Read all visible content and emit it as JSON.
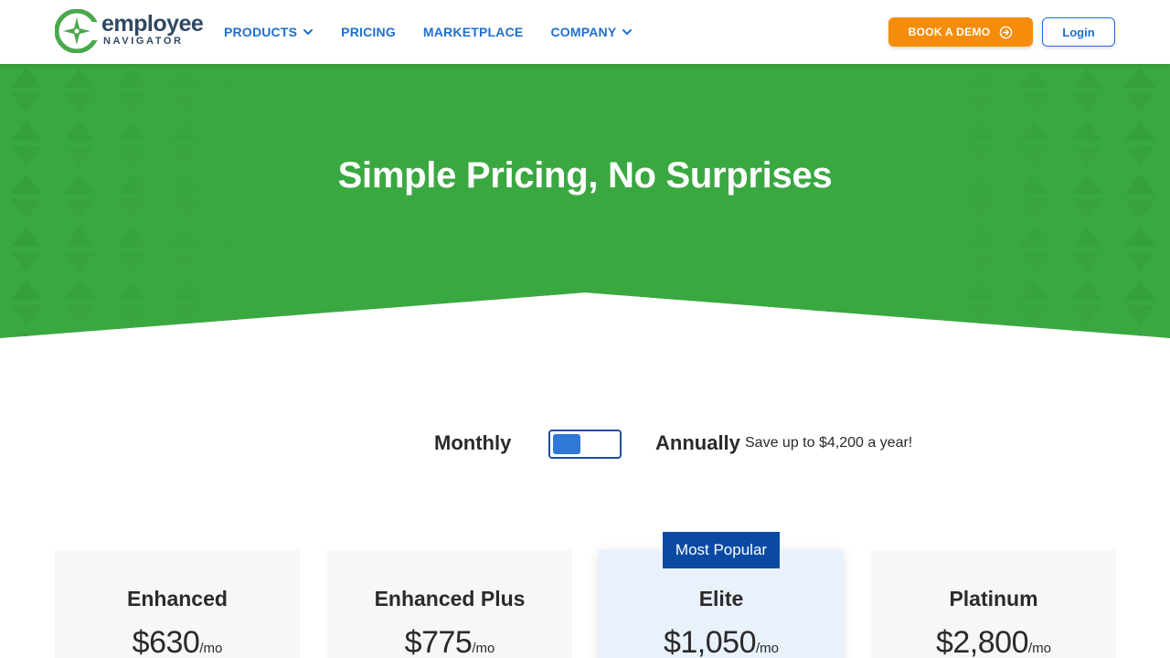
{
  "brand": {
    "logo_word": "employee",
    "logo_sub": "NAVIGATOR",
    "primary_color": "#1f6fcf",
    "hero_green": "#3aa840",
    "accent_orange": "#f68d0a"
  },
  "nav": {
    "items": [
      {
        "label": "PRODUCTS",
        "has_dropdown": true
      },
      {
        "label": "PRICING",
        "has_dropdown": false
      },
      {
        "label": "MARKETPLACE",
        "has_dropdown": false
      },
      {
        "label": "COMPANY",
        "has_dropdown": true
      }
    ],
    "book_demo_label": "BOOK A DEMO",
    "login_label": "Login"
  },
  "hero": {
    "title": "Simple Pricing, No Surprises"
  },
  "billing": {
    "monthly_label": "Monthly",
    "annual_label": "Annually",
    "save_note": "Save up to $4,200 a year!",
    "selected": "Monthly"
  },
  "plans": [
    {
      "name": "Enhanced",
      "price": "$630",
      "unit": "/mo"
    },
    {
      "name": "Enhanced Plus",
      "price": "$775",
      "unit": "/mo"
    },
    {
      "name": "Elite",
      "price": "$1,050",
      "unit": "/mo",
      "badge": "Most Popular"
    },
    {
      "name": "Platinum",
      "price": "$2,800",
      "unit": "/mo"
    }
  ]
}
